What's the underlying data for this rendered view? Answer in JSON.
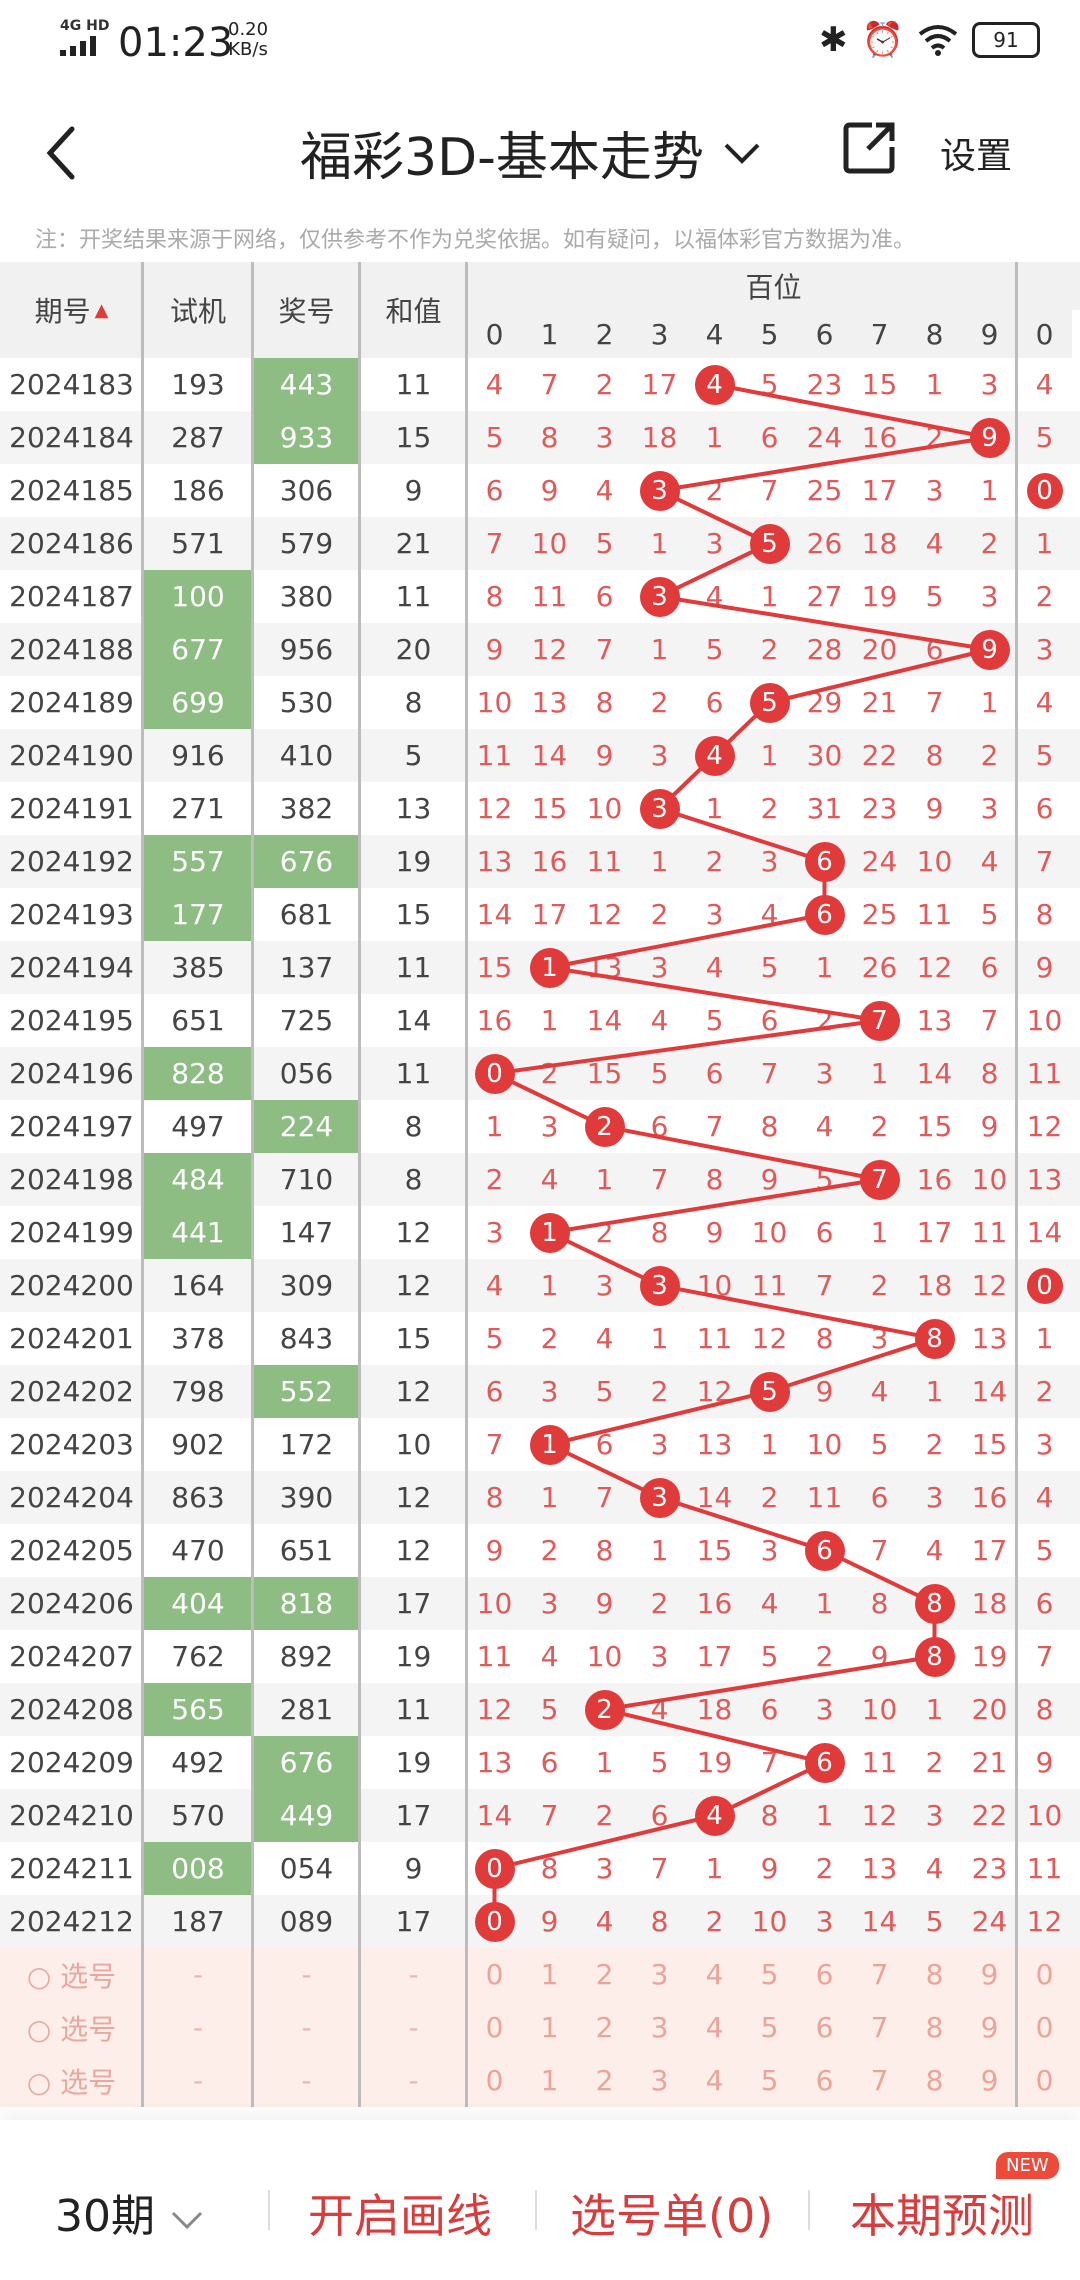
{
  "status": {
    "network": "4G HD",
    "time": "01:23",
    "speed": "0.20",
    "speed_unit": "KB/s",
    "battery": "91"
  },
  "header": {
    "title": "福彩3D-基本走势",
    "settings": "设置"
  },
  "notice": "注：开奖结果来源于网络，仅供参考不作为兑奖依据。如有疑问，以福体彩官方数据为准。",
  "columns": {
    "period": "期号",
    "trial": "试机",
    "prize": "奖号",
    "sum": "和值",
    "hundreds": "百位",
    "digits": [
      "0",
      "1",
      "2",
      "3",
      "4",
      "5",
      "6",
      "7",
      "8",
      "9",
      "0"
    ]
  },
  "rows": [
    {
      "period": "2024183",
      "trial": "193",
      "prize": "443",
      "sum": "11",
      "th": false,
      "ph": true,
      "vals": [
        "4",
        "7",
        "2",
        "17",
        "4",
        "5",
        "23",
        "15",
        "1",
        "3",
        "4"
      ],
      "hit": 4
    },
    {
      "period": "2024184",
      "trial": "287",
      "prize": "933",
      "sum": "15",
      "th": false,
      "ph": true,
      "vals": [
        "5",
        "8",
        "3",
        "18",
        "1",
        "6",
        "24",
        "16",
        "2",
        "9",
        "5"
      ],
      "hit": 9
    },
    {
      "period": "2024185",
      "trial": "186",
      "prize": "306",
      "sum": "9",
      "th": false,
      "ph": false,
      "vals": [
        "6",
        "9",
        "4",
        "3",
        "2",
        "7",
        "25",
        "17",
        "3",
        "1",
        "0"
      ],
      "hit": 3
    },
    {
      "period": "2024186",
      "trial": "571",
      "prize": "579",
      "sum": "21",
      "th": false,
      "ph": false,
      "vals": [
        "7",
        "10",
        "5",
        "1",
        "3",
        "5",
        "26",
        "18",
        "4",
        "2",
        "1"
      ],
      "hit": 5
    },
    {
      "period": "2024187",
      "trial": "100",
      "prize": "380",
      "sum": "11",
      "th": true,
      "ph": false,
      "vals": [
        "8",
        "11",
        "6",
        "3",
        "4",
        "1",
        "27",
        "19",
        "5",
        "3",
        "2"
      ],
      "hit": 3
    },
    {
      "period": "2024188",
      "trial": "677",
      "prize": "956",
      "sum": "20",
      "th": true,
      "ph": false,
      "vals": [
        "9",
        "12",
        "7",
        "1",
        "5",
        "2",
        "28",
        "20",
        "6",
        "9",
        "3"
      ],
      "hit": 9
    },
    {
      "period": "2024189",
      "trial": "699",
      "prize": "530",
      "sum": "8",
      "th": true,
      "ph": false,
      "vals": [
        "10",
        "13",
        "8",
        "2",
        "6",
        "5",
        "29",
        "21",
        "7",
        "1",
        "4"
      ],
      "hit": 5
    },
    {
      "period": "2024190",
      "trial": "916",
      "prize": "410",
      "sum": "5",
      "th": false,
      "ph": false,
      "vals": [
        "11",
        "14",
        "9",
        "3",
        "4",
        "1",
        "30",
        "22",
        "8",
        "2",
        "5"
      ],
      "hit": 4
    },
    {
      "period": "2024191",
      "trial": "271",
      "prize": "382",
      "sum": "13",
      "th": false,
      "ph": false,
      "vals": [
        "12",
        "15",
        "10",
        "3",
        "1",
        "2",
        "31",
        "23",
        "9",
        "3",
        "6"
      ],
      "hit": 3
    },
    {
      "period": "2024192",
      "trial": "557",
      "prize": "676",
      "sum": "19",
      "th": true,
      "ph": true,
      "vals": [
        "13",
        "16",
        "11",
        "1",
        "2",
        "3",
        "6",
        "24",
        "10",
        "4",
        "7"
      ],
      "hit": 6
    },
    {
      "period": "2024193",
      "trial": "177",
      "prize": "681",
      "sum": "15",
      "th": true,
      "ph": false,
      "vals": [
        "14",
        "17",
        "12",
        "2",
        "3",
        "4",
        "6",
        "25",
        "11",
        "5",
        "8"
      ],
      "hit": 6
    },
    {
      "period": "2024194",
      "trial": "385",
      "prize": "137",
      "sum": "11",
      "th": false,
      "ph": false,
      "vals": [
        "15",
        "1",
        "13",
        "3",
        "4",
        "5",
        "1",
        "26",
        "12",
        "6",
        "9"
      ],
      "hit": 1
    },
    {
      "period": "2024195",
      "trial": "651",
      "prize": "725",
      "sum": "14",
      "th": false,
      "ph": false,
      "vals": [
        "16",
        "1",
        "14",
        "4",
        "5",
        "6",
        "2",
        "7",
        "13",
        "7",
        "10"
      ],
      "hit": 7
    },
    {
      "period": "2024196",
      "trial": "828",
      "prize": "056",
      "sum": "11",
      "th": true,
      "ph": false,
      "vals": [
        "0",
        "2",
        "15",
        "5",
        "6",
        "7",
        "3",
        "1",
        "14",
        "8",
        "11"
      ],
      "hit": 0
    },
    {
      "period": "2024197",
      "trial": "497",
      "prize": "224",
      "sum": "8",
      "th": false,
      "ph": true,
      "vals": [
        "1",
        "3",
        "2",
        "6",
        "7",
        "8",
        "4",
        "2",
        "15",
        "9",
        "12"
      ],
      "hit": 2
    },
    {
      "period": "2024198",
      "trial": "484",
      "prize": "710",
      "sum": "8",
      "th": true,
      "ph": false,
      "vals": [
        "2",
        "4",
        "1",
        "7",
        "8",
        "9",
        "5",
        "7",
        "16",
        "10",
        "13"
      ],
      "hit": 7
    },
    {
      "period": "2024199",
      "trial": "441",
      "prize": "147",
      "sum": "12",
      "th": true,
      "ph": false,
      "vals": [
        "3",
        "1",
        "2",
        "8",
        "9",
        "10",
        "6",
        "1",
        "17",
        "11",
        "14"
      ],
      "hit": 1
    },
    {
      "period": "2024200",
      "trial": "164",
      "prize": "309",
      "sum": "12",
      "th": false,
      "ph": false,
      "vals": [
        "4",
        "1",
        "3",
        "3",
        "10",
        "11",
        "7",
        "2",
        "18",
        "12",
        "0"
      ],
      "hit": 3
    },
    {
      "period": "2024201",
      "trial": "378",
      "prize": "843",
      "sum": "15",
      "th": false,
      "ph": false,
      "vals": [
        "5",
        "2",
        "4",
        "1",
        "11",
        "12",
        "8",
        "3",
        "8",
        "13",
        "1"
      ],
      "hit": 8
    },
    {
      "period": "2024202",
      "trial": "798",
      "prize": "552",
      "sum": "12",
      "th": false,
      "ph": true,
      "vals": [
        "6",
        "3",
        "5",
        "2",
        "12",
        "5",
        "9",
        "4",
        "1",
        "14",
        "2"
      ],
      "hit": 5
    },
    {
      "period": "2024203",
      "trial": "902",
      "prize": "172",
      "sum": "10",
      "th": false,
      "ph": false,
      "vals": [
        "7",
        "1",
        "6",
        "3",
        "13",
        "1",
        "10",
        "5",
        "2",
        "15",
        "3"
      ],
      "hit": 1
    },
    {
      "period": "2024204",
      "trial": "863",
      "prize": "390",
      "sum": "12",
      "th": false,
      "ph": false,
      "vals": [
        "8",
        "1",
        "7",
        "3",
        "14",
        "2",
        "11",
        "6",
        "3",
        "16",
        "4"
      ],
      "hit": 3
    },
    {
      "period": "2024205",
      "trial": "470",
      "prize": "651",
      "sum": "12",
      "th": false,
      "ph": false,
      "vals": [
        "9",
        "2",
        "8",
        "1",
        "15",
        "3",
        "6",
        "7",
        "4",
        "17",
        "5"
      ],
      "hit": 6
    },
    {
      "period": "2024206",
      "trial": "404",
      "prize": "818",
      "sum": "17",
      "th": true,
      "ph": true,
      "vals": [
        "10",
        "3",
        "9",
        "2",
        "16",
        "4",
        "1",
        "8",
        "8",
        "18",
        "6"
      ],
      "hit": 8
    },
    {
      "period": "2024207",
      "trial": "762",
      "prize": "892",
      "sum": "19",
      "th": false,
      "ph": false,
      "vals": [
        "11",
        "4",
        "10",
        "3",
        "17",
        "5",
        "2",
        "9",
        "8",
        "19",
        "7"
      ],
      "hit": 8
    },
    {
      "period": "2024208",
      "trial": "565",
      "prize": "281",
      "sum": "11",
      "th": true,
      "ph": false,
      "vals": [
        "12",
        "5",
        "2",
        "4",
        "18",
        "6",
        "3",
        "10",
        "1",
        "20",
        "8"
      ],
      "hit": 2
    },
    {
      "period": "2024209",
      "trial": "492",
      "prize": "676",
      "sum": "19",
      "th": false,
      "ph": true,
      "vals": [
        "13",
        "6",
        "1",
        "5",
        "19",
        "7",
        "6",
        "11",
        "2",
        "21",
        "9"
      ],
      "hit": 6
    },
    {
      "period": "2024210",
      "trial": "570",
      "prize": "449",
      "sum": "17",
      "th": false,
      "ph": true,
      "vals": [
        "14",
        "7",
        "2",
        "6",
        "4",
        "8",
        "1",
        "12",
        "3",
        "22",
        "10"
      ],
      "hit": 4
    },
    {
      "period": "2024211",
      "trial": "008",
      "prize": "054",
      "sum": "9",
      "th": true,
      "ph": false,
      "vals": [
        "0",
        "8",
        "3",
        "7",
        "1",
        "9",
        "2",
        "13",
        "4",
        "23",
        "11"
      ],
      "hit": 0
    },
    {
      "period": "2024212",
      "trial": "187",
      "prize": "089",
      "sum": "17",
      "th": false,
      "ph": false,
      "vals": [
        "0",
        "9",
        "4",
        "8",
        "2",
        "10",
        "3",
        "14",
        "5",
        "24",
        "12"
      ],
      "hit": 0
    }
  ],
  "select_rows": {
    "label": "选号",
    "placeholder": "-",
    "vals": [
      "0",
      "1",
      "2",
      "3",
      "4",
      "5",
      "6",
      "7",
      "8",
      "9",
      "0"
    ]
  },
  "bottom": {
    "period": "30期",
    "draw": "开启画线",
    "selection": "选号单(0)",
    "predict": "本期预测",
    "badge": "NEW"
  },
  "colors": {
    "accent": "#e03a3a",
    "highlight": "#8dbd83"
  }
}
